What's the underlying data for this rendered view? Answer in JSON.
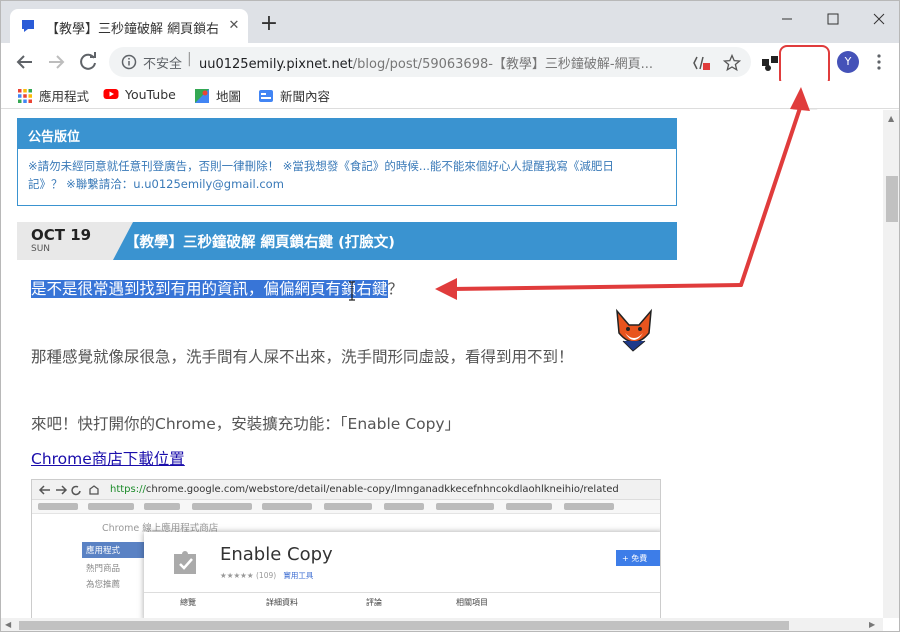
{
  "tab": {
    "title": "【教學】三秒鐘破解 網頁鎖右鍵",
    "close": "✕"
  },
  "newtab": "+",
  "address": {
    "security": "不安全",
    "separator": "|",
    "url_host": "uu0125emily.pixnet.net",
    "url_path": "/blog/post/59063698-【教學】三秒鐘破解-網頁..."
  },
  "profile": {
    "initial": "Y"
  },
  "extension": {
    "label": "JS"
  },
  "bookmarks": [
    {
      "label": "應用程式",
      "icon": "apps-grid-icon"
    },
    {
      "label": "YouTube",
      "icon": "youtube-icon"
    },
    {
      "label": "地圖",
      "icon": "maps-icon"
    },
    {
      "label": "新聞內容",
      "icon": "news-icon"
    }
  ],
  "announcement": {
    "title": "公告版位",
    "line1": "※請勿未經同意就任意刊登廣告，否則一律刪除！ ※當我想發《食記》的時候...能不能來個好心人提醒我寫《減肥日",
    "line2": "記》？ ※聯繫請洽：u.u0125emily@gmail.com"
  },
  "post": {
    "date_md": "OCT 19",
    "date_dow": "SUN",
    "title": "【教學】三秒鐘破解 網頁鎖右鍵 (打臉文)"
  },
  "body": {
    "p1_selected": "是不是很常遇到找到有用的資訊，偏偏網頁有鎖右鍵",
    "p1_rest": "？",
    "p2": "那種感覺就像尿很急，洗手間有人屎不出來，洗手間形同虛設，看得到用不到！",
    "p3": "來吧！快打開你的Chrome，安裝擴充功能：「Enable Copy」",
    "link": "Chrome商店下載位置"
  },
  "embedded": {
    "url_secure": "https://",
    "url_rest": "chrome.google.com/webstore/detail/enable-copy/lmnganadkkecefnhncokdlaohlkneihio/related",
    "store_label": "Chrome 線上應用程式商店",
    "sidebar": [
      "應用程式",
      "熱門商品",
      "為您推薦"
    ],
    "ext_name": "Enable Copy",
    "rating": "★★★★★ (109)",
    "category": "實用工具",
    "add_button": "+ 免費",
    "card_tabs": [
      "總覽",
      "詳細資料",
      "評論",
      "相關項目"
    ]
  },
  "colors": {
    "accent": "#3a93d0",
    "selection": "#3875d7",
    "annotation": "#e03c3c"
  }
}
